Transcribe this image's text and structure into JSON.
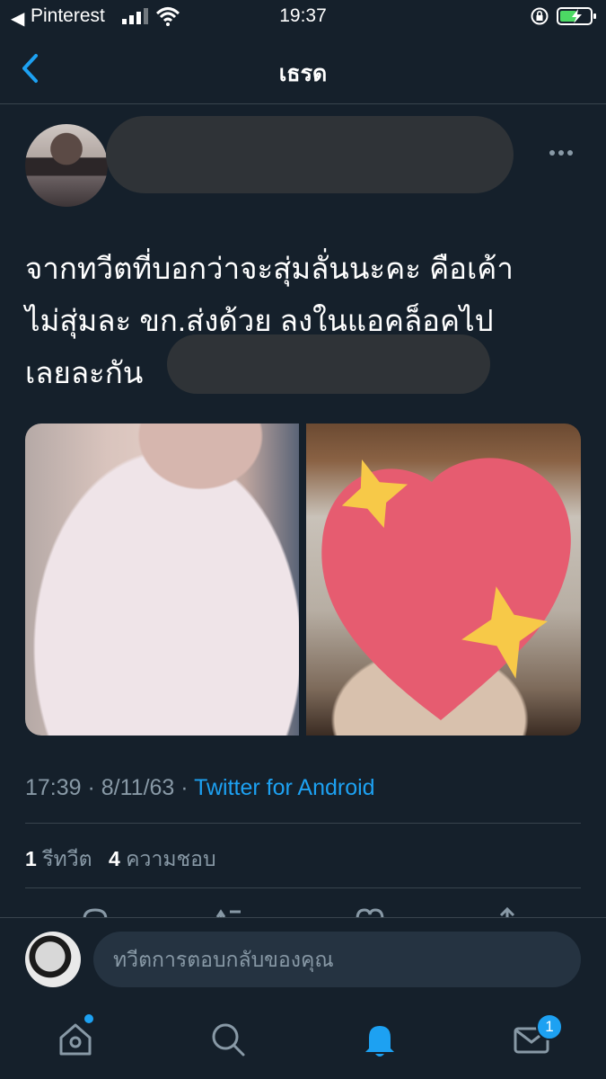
{
  "status_bar": {
    "back_app": "Pinterest",
    "time": "19:37"
  },
  "nav": {
    "title": "เธรด"
  },
  "tweet": {
    "text_lines": [
      "จากทวีตที่บอกว่าจะสุ่มลั่นนะคะ คือเค้า",
      "ไม่สุ่มละ ขก.ส่งด้วย ลงในแอคล็อคไป",
      "เลยละกัน"
    ],
    "time": "17:39",
    "date": "8/11/63",
    "separator": " · ",
    "source": "Twitter for Android",
    "retweets": {
      "count": "1",
      "label": "รีทวีต"
    },
    "likes": {
      "count": "4",
      "label": "ความชอบ"
    }
  },
  "reply": {
    "placeholder": "ทวีตการตอบกลับของคุณ"
  },
  "tabbar": {
    "messages_badge": "1"
  },
  "colors": {
    "background": "#15202b",
    "accent": "#1da1f2",
    "secondary_text": "#8899a6",
    "divider": "#38444d"
  },
  "icons": [
    "back-chevron-icon",
    "more-icon",
    "home-icon",
    "search-icon",
    "notifications-bell-icon",
    "messages-mail-icon"
  ]
}
